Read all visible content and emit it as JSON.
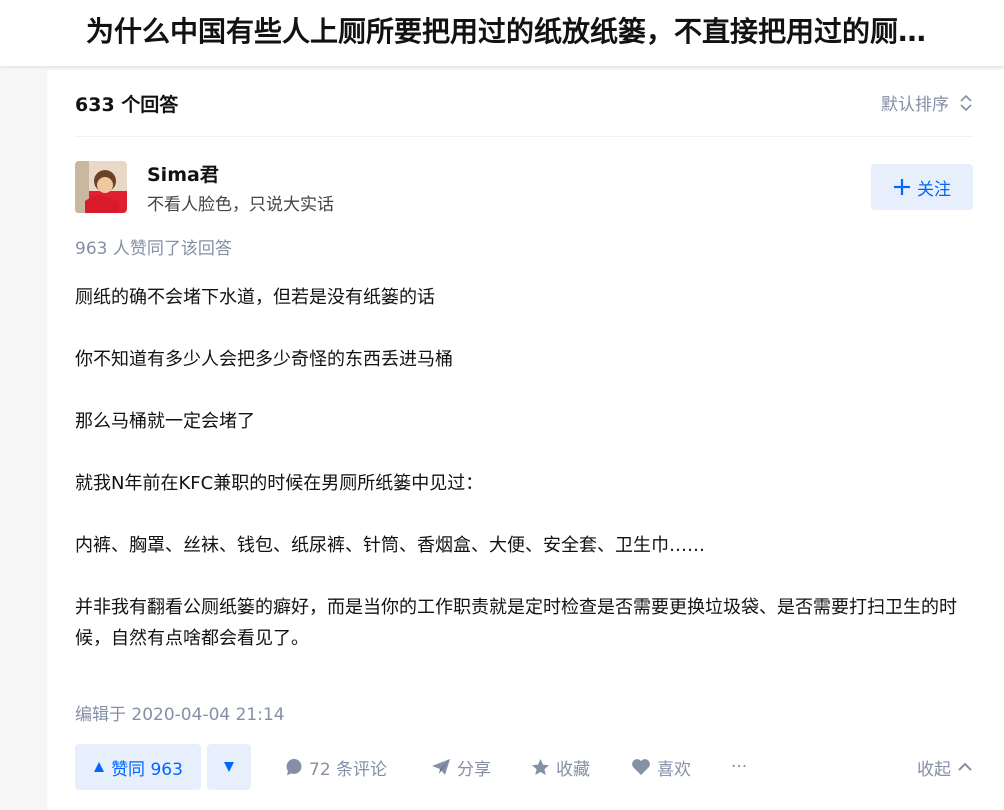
{
  "question": {
    "title": "为什么中国有些人上厕所要把用过的纸放纸篓，不直接把用过的厕…"
  },
  "answers_header": {
    "count_label": "633 个回答",
    "sort_label": "默认排序",
    "sort_icon": "sort-updown-icon"
  },
  "author": {
    "name": "Sima君",
    "headline": "不看人脸色，只说大实话",
    "avatar_icon": "avatar-photo",
    "follow_label": "关注",
    "follow_icon": "plus-icon"
  },
  "vote_summary": "963 人赞同了该回答",
  "answer": {
    "paragraphs": [
      "厕纸的确不会堵下水道，但若是没有纸篓的话",
      "你不知道有多少人会把多少奇怪的东西丢进马桶",
      "那么马桶就一定会堵了",
      "就我N年前在KFC兼职的时候在男厕所纸篓中见过：",
      "内裤、胸罩、丝袜、钱包、纸尿裤、针筒、香烟盒、大便、安全套、卫生巾……",
      "并非我有翻看公厕纸篓的癖好，而是当你的工作职责就是定时检查是否需要更换垃圾袋、是否需要打扫卫生的时候，自然有点啥都会看见了。"
    ]
  },
  "edit_time": "编辑于 2020-04-04 21:14",
  "actions": {
    "upvote_label": "赞同 963",
    "comments_label": "72 条评论",
    "share_label": "分享",
    "collect_label": "收藏",
    "like_label": "喜欢",
    "more_label": "···",
    "collapse_label": "收起"
  },
  "colors": {
    "brand_blue": "#0066ff",
    "brand_blue_bg": "#e6effb",
    "meta_gray": "#8590a6",
    "text": "#121212"
  }
}
